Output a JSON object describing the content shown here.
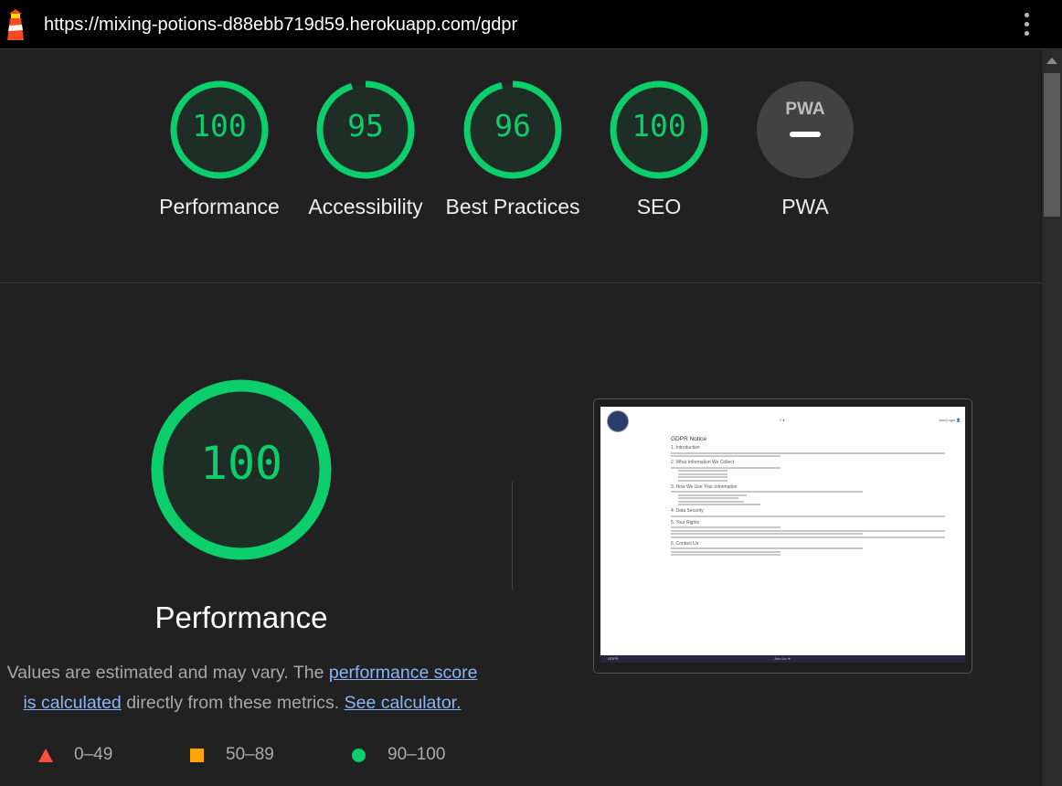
{
  "browser": {
    "url": "https://mixing-potions-d88ebb719d59.herokuapp.com/gdpr"
  },
  "categories": [
    {
      "label": "Performance",
      "score": "100",
      "value": 100
    },
    {
      "label": "Accessibility",
      "score": "95",
      "value": 95
    },
    {
      "label": "Best Practices",
      "score": "96",
      "value": 96
    },
    {
      "label": "SEO",
      "score": "100",
      "value": 100
    },
    {
      "label": "PWA",
      "badge": "PWA"
    }
  ],
  "performance": {
    "score": "100",
    "title": "Performance",
    "desc_pre": "Values are estimated and may vary. The ",
    "desc_link1": "performance score is calculated",
    "desc_mid": " directly from these metrics. ",
    "desc_link2": "See calculator."
  },
  "legend": {
    "fail": "0–49",
    "average": "50–89",
    "pass": "90–100"
  },
  "screenshot": {
    "nav_center": "≡ ▾",
    "nav_right": "Join/Login 👤",
    "page_title": "GDPR Notice",
    "sections": [
      "1. Introduction",
      "2. What Information We Collect",
      "3. How We Use Your Information",
      "4. Data Security",
      "5. Your Rights",
      "6. Contact Us"
    ],
    "footer_left": "GDPR",
    "footer_center": "Join Us ➜"
  },
  "colors": {
    "pass": "#0cce6b",
    "average": "#ffa400",
    "fail": "#ff4e42",
    "link": "#8ab4f8"
  }
}
